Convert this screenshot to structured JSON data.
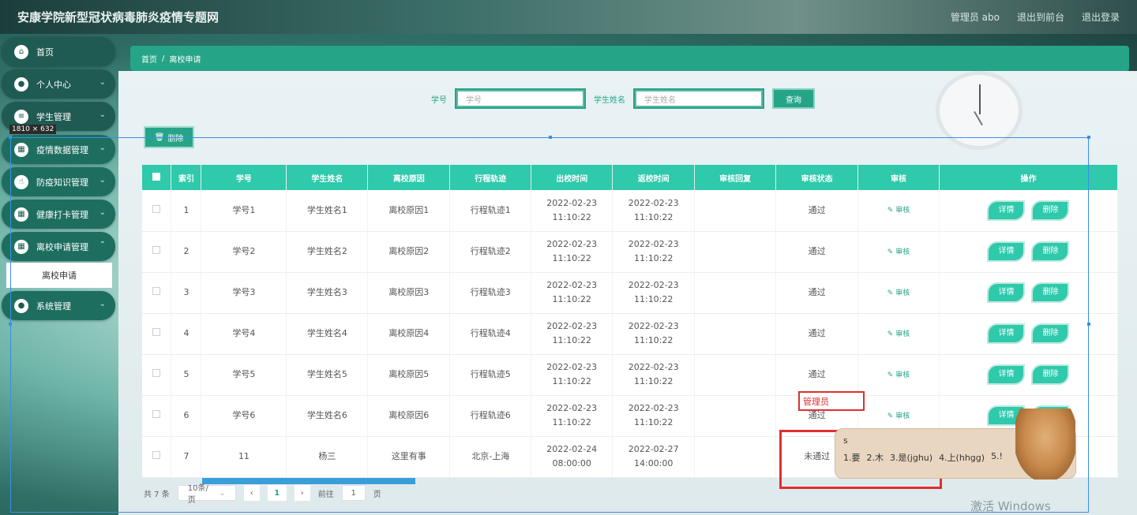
{
  "header": {
    "site_title": "安康学院新型冠状病毒肺炎疫情专题网",
    "user": "管理员 abo",
    "to_front": "退出到前台",
    "logout": "退出登录"
  },
  "sidebar": {
    "items": [
      {
        "label": "首页"
      },
      {
        "label": "个人中心"
      },
      {
        "label": "学生管理"
      },
      {
        "label": "疫情数据管理"
      },
      {
        "label": "防疫知识管理"
      },
      {
        "label": "健康打卡管理"
      },
      {
        "label": "离校申请管理"
      },
      {
        "label": "系统管理"
      }
    ],
    "active_sub": "离校申请"
  },
  "breadcrumb": {
    "home": "首页",
    "sep": "/",
    "current": "离校申请"
  },
  "size_label": "1810 × 632",
  "search": {
    "student_no_label": "学号",
    "student_no_placeholder": "学号",
    "student_name_label": "学生姓名",
    "student_name_placeholder": "学生姓名",
    "query_button": "查询"
  },
  "batch_delete": "删除",
  "table": {
    "headers": [
      "索引",
      "学号",
      "学生姓名",
      "离校原因",
      "行程轨迹",
      "出校时间",
      "返校时间",
      "审核回复",
      "审核状态",
      "审核",
      "操作"
    ],
    "audit_link": "审核",
    "detail_btn": "详情",
    "delete_btn": "删除",
    "rows": [
      {
        "idx": "1",
        "no": "学号1",
        "name": "学生姓名1",
        "reason": "离校原因1",
        "track": "行程轨迹1",
        "out": "2022-02-23 11:10:22",
        "back": "2022-02-23 11:10:22",
        "reply": "",
        "status": "通过"
      },
      {
        "idx": "2",
        "no": "学号2",
        "name": "学生姓名2",
        "reason": "离校原因2",
        "track": "行程轨迹2",
        "out": "2022-02-23 11:10:22",
        "back": "2022-02-23 11:10:22",
        "reply": "",
        "status": "通过"
      },
      {
        "idx": "3",
        "no": "学号3",
        "name": "学生姓名3",
        "reason": "离校原因3",
        "track": "行程轨迹3",
        "out": "2022-02-23 11:10:22",
        "back": "2022-02-23 11:10:22",
        "reply": "",
        "status": "通过"
      },
      {
        "idx": "4",
        "no": "学号4",
        "name": "学生姓名4",
        "reason": "离校原因4",
        "track": "行程轨迹4",
        "out": "2022-02-23 11:10:22",
        "back": "2022-02-23 11:10:22",
        "reply": "",
        "status": "通过"
      },
      {
        "idx": "5",
        "no": "学号5",
        "name": "学生姓名5",
        "reason": "离校原因5",
        "track": "行程轨迹5",
        "out": "2022-02-23 11:10:22",
        "back": "2022-02-23 11:10:22",
        "reply": "",
        "status": "通过"
      },
      {
        "idx": "6",
        "no": "学号6",
        "name": "学生姓名6",
        "reason": "离校原因6",
        "track": "行程轨迹6",
        "out": "2022-02-23 11:10:22",
        "back": "2022-02-23 11:10:22",
        "reply": "",
        "status": "通过"
      },
      {
        "idx": "7",
        "no": "11",
        "name": "杨三",
        "reason": "这里有事",
        "track": "北京-上海",
        "out": "2022-02-24 08:00:00",
        "back": "2022-02-27 14:00:00",
        "reply": "",
        "status": "未通过"
      }
    ]
  },
  "pager": {
    "total": "共 7 条",
    "page_size": "10条/页",
    "current_page": "1",
    "goto_label": "前往",
    "goto_value": "1",
    "page_suffix": "页"
  },
  "annotation": {
    "edit_text": "管理员"
  },
  "ime": {
    "composition": "s",
    "candidates": [
      "1.要",
      "2.木",
      "3.是(jghu)",
      "4.上(hhgg)",
      "5.!"
    ]
  },
  "watermark": "激活 Windows"
}
